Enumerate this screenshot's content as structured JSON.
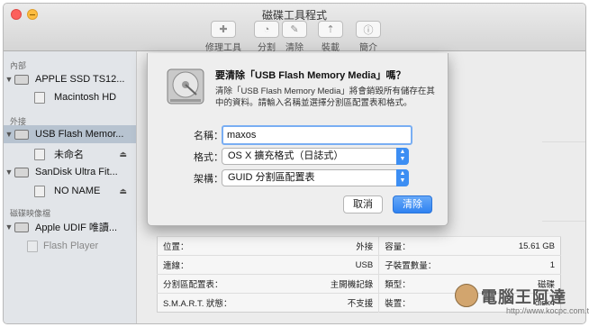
{
  "window": {
    "title": "磁碟工具程式"
  },
  "toolbar": {
    "items": [
      {
        "label": "修理工具",
        "icon": "stethoscope-icon"
      },
      {
        "label": "分割",
        "icon": "partition-icon"
      },
      {
        "label": "清除",
        "icon": "erase-icon"
      },
      {
        "label": "裝載",
        "icon": "mount-icon"
      },
      {
        "label": "簡介",
        "icon": "info-icon"
      }
    ]
  },
  "sidebar": {
    "sections": {
      "internal": "內部",
      "external": "外接",
      "disk_images": "磁碟映像檔"
    },
    "items": [
      {
        "label": "APPLE SSD TS12..."
      },
      {
        "label": "Macintosh HD"
      },
      {
        "label": "USB Flash Memor..."
      },
      {
        "label": "未命名"
      },
      {
        "label": "SanDisk Ultra Fit..."
      },
      {
        "label": "NO NAME"
      },
      {
        "label": "Apple UDIF 唯讀..."
      },
      {
        "label": "Flash Player"
      }
    ]
  },
  "dialog": {
    "title": "要清除「USB Flash Memory Media」嗎？",
    "message": "清除「USB Flash Memory Media」將會銷毀所有儲存在其中的資料。請輸入名稱並選擇分割區配置表和格式。",
    "name_label": "名稱：",
    "name_value": "maxos",
    "format_label": "格式：",
    "format_value": "OS X 擴充格式（日誌式）",
    "scheme_label": "架構：",
    "scheme_value": "GUID 分割區配置表",
    "cancel_label": "取消",
    "erase_label": "清除"
  },
  "info": {
    "rows": [
      {
        "l_label": "位置：",
        "l_value": "外接",
        "r_label": "容量：",
        "r_value": "15.61 GB"
      },
      {
        "l_label": "連線：",
        "l_value": "USB",
        "r_label": "子裝置數量：",
        "r_value": "1"
      },
      {
        "l_label": "分割區配置表：",
        "l_value": "主開機記錄",
        "r_label": "類型：",
        "r_value": "磁碟"
      },
      {
        "l_label": "S.M.A.R.T. 狀態：",
        "l_value": "不支援",
        "r_label": "裝置：",
        "r_value": "disk4"
      }
    ]
  },
  "watermark": {
    "text": "電腦王阿達",
    "url": "http://www.kocpc.com.tw"
  },
  "colors": {
    "accent": "#2c92f0",
    "selection": "#b7c3d0"
  }
}
